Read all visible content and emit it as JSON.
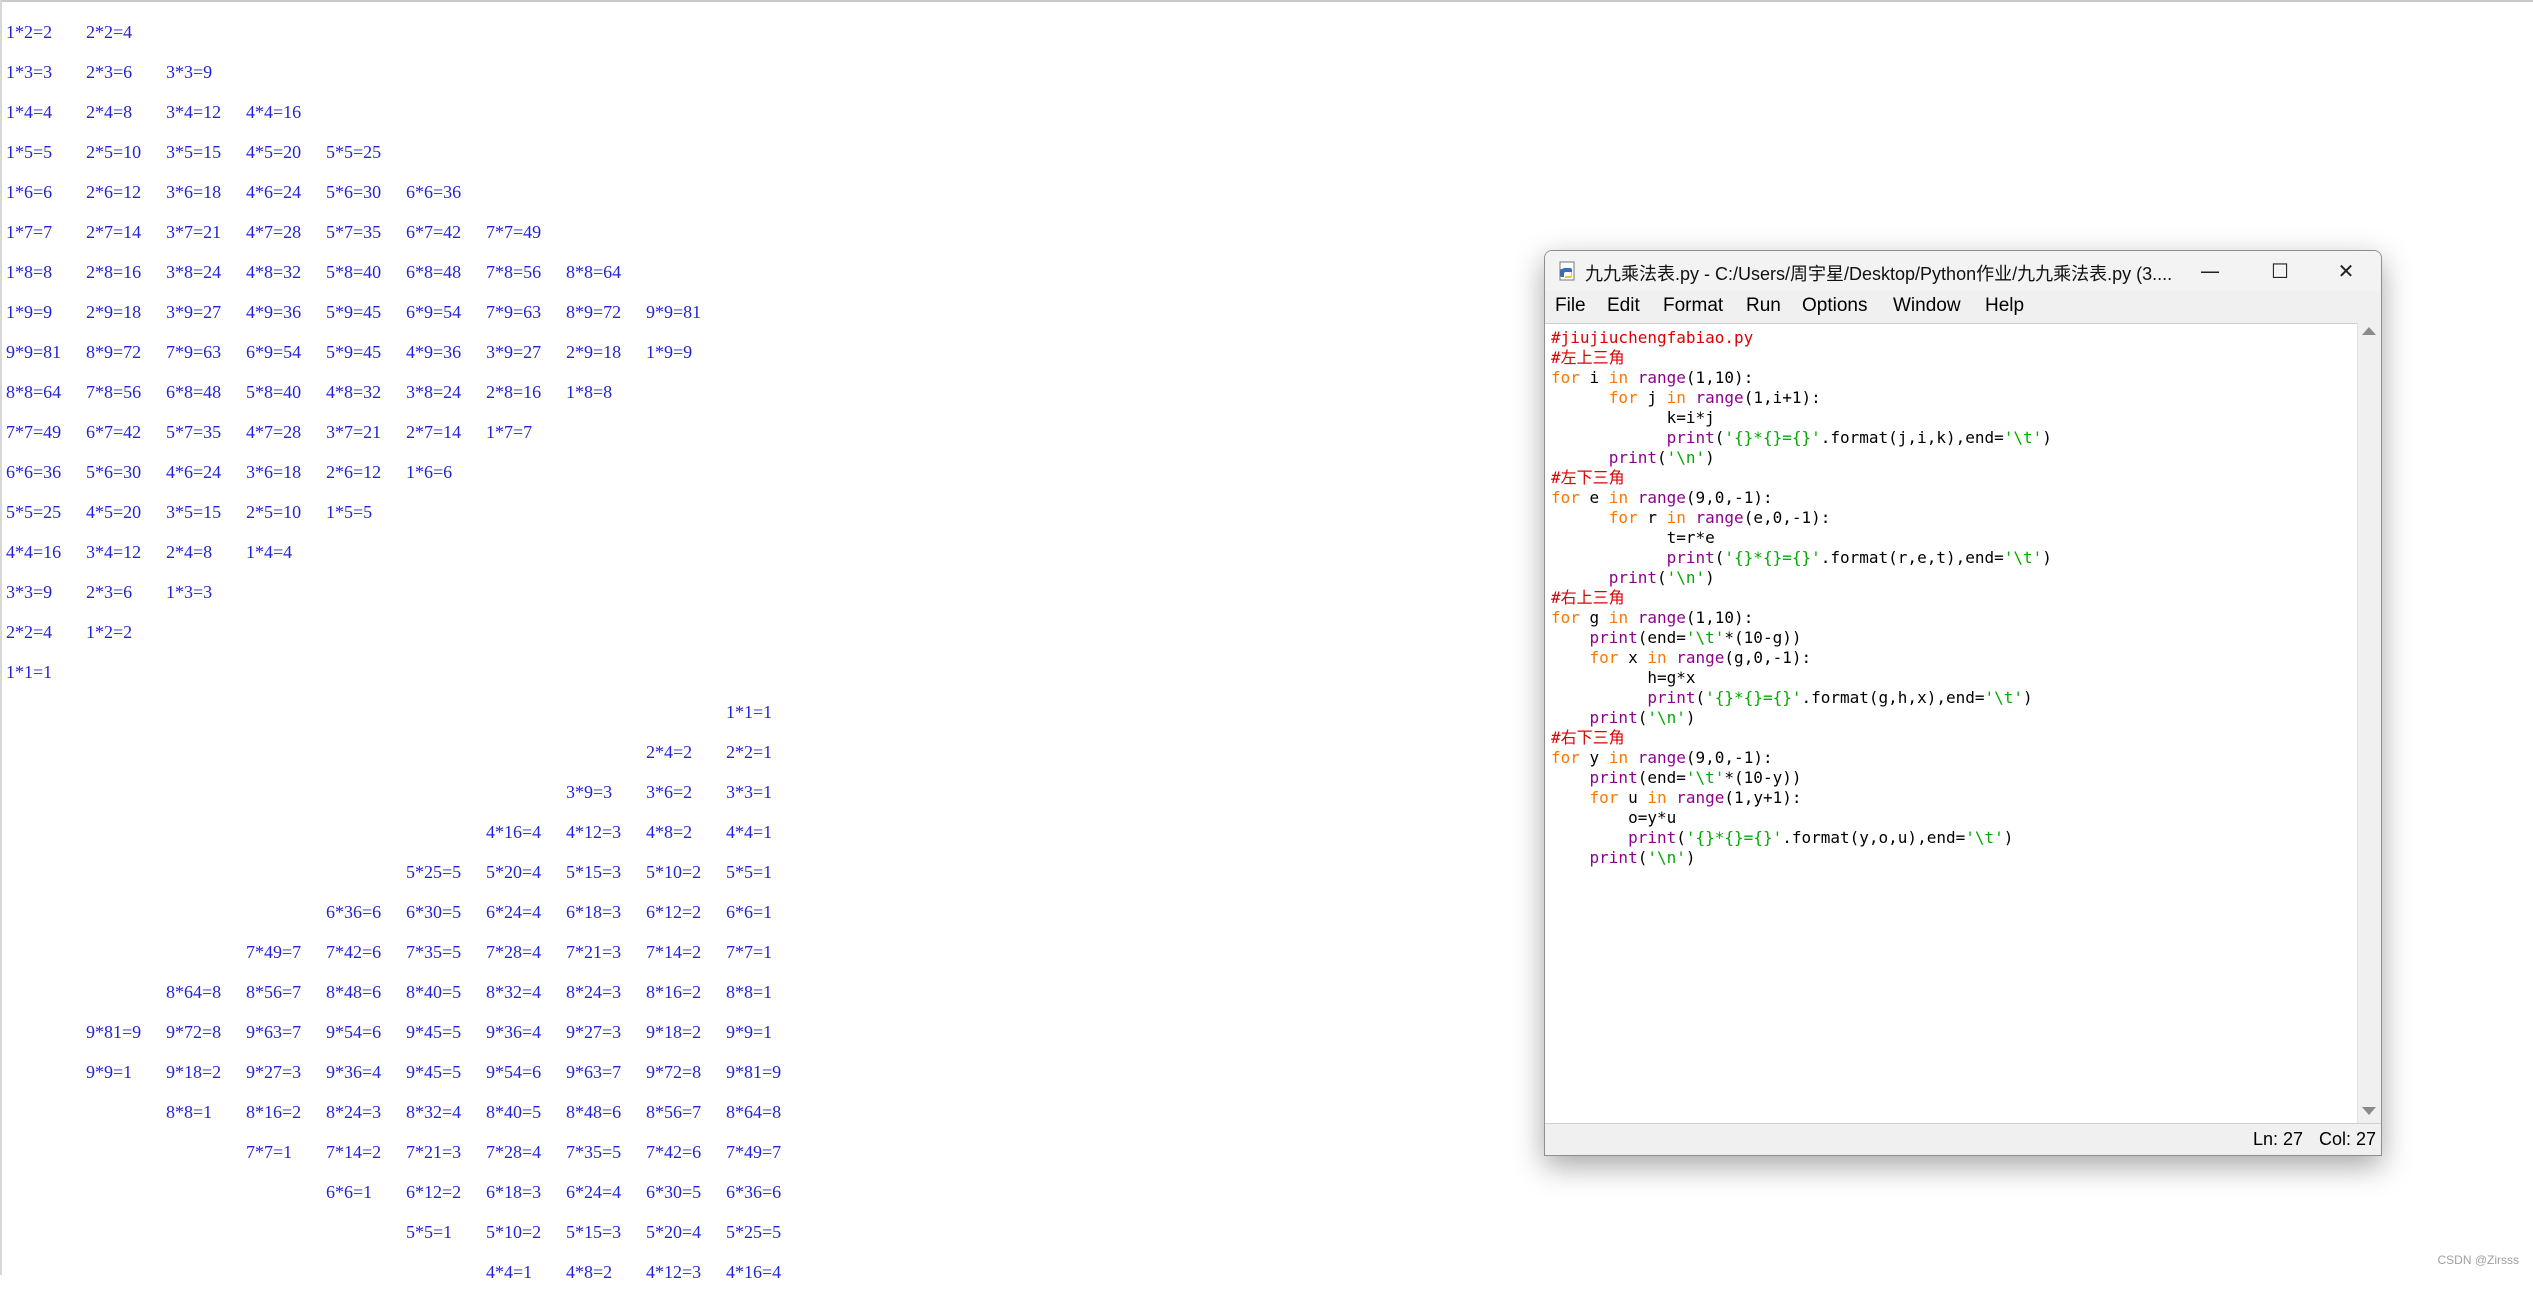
{
  "shell_output": [
    [
      "1*2=2",
      "2*2=4",
      "",
      "",
      "",
      "",
      "",
      "",
      ""
    ],
    [
      "1*3=3",
      "2*3=6",
      "3*3=9",
      "",
      "",
      "",
      "",
      "",
      ""
    ],
    [
      "1*4=4",
      "2*4=8",
      "3*4=12",
      "4*4=16",
      "",
      "",
      "",
      "",
      ""
    ],
    [
      "1*5=5",
      "2*5=10",
      "3*5=15",
      "4*5=20",
      "5*5=25",
      "",
      "",
      "",
      ""
    ],
    [
      "1*6=6",
      "2*6=12",
      "3*6=18",
      "4*6=24",
      "5*6=30",
      "6*6=36",
      "",
      "",
      ""
    ],
    [
      "1*7=7",
      "2*7=14",
      "3*7=21",
      "4*7=28",
      "5*7=35",
      "6*7=42",
      "7*7=49",
      "",
      ""
    ],
    [
      "1*8=8",
      "2*8=16",
      "3*8=24",
      "4*8=32",
      "5*8=40",
      "6*8=48",
      "7*8=56",
      "8*8=64",
      ""
    ],
    [
      "1*9=9",
      "2*9=18",
      "3*9=27",
      "4*9=36",
      "5*9=45",
      "6*9=54",
      "7*9=63",
      "8*9=72",
      "9*9=81"
    ],
    [
      "9*9=81",
      "8*9=72",
      "7*9=63",
      "6*9=54",
      "5*9=45",
      "4*9=36",
      "3*9=27",
      "2*9=18",
      "1*9=9"
    ],
    [
      "8*8=64",
      "7*8=56",
      "6*8=48",
      "5*8=40",
      "4*8=32",
      "3*8=24",
      "2*8=16",
      "1*8=8",
      ""
    ],
    [
      "7*7=49",
      "6*7=42",
      "5*7=35",
      "4*7=28",
      "3*7=21",
      "2*7=14",
      "1*7=7",
      "",
      ""
    ],
    [
      "6*6=36",
      "5*6=30",
      "4*6=24",
      "3*6=18",
      "2*6=12",
      "1*6=6",
      "",
      "",
      ""
    ],
    [
      "5*5=25",
      "4*5=20",
      "3*5=15",
      "2*5=10",
      "1*5=5",
      "",
      "",
      "",
      ""
    ],
    [
      "4*4=16",
      "3*4=12",
      "2*4=8",
      "1*4=4",
      "",
      "",
      "",
      "",
      ""
    ],
    [
      "3*3=9",
      "2*3=6",
      "1*3=3",
      "",
      "",
      "",
      "",
      "",
      ""
    ],
    [
      "2*2=4",
      "1*2=2",
      "",
      "",
      "",
      "",
      "",
      "",
      ""
    ],
    [
      "1*1=1",
      "",
      "",
      "",
      "",
      "",
      "",
      "",
      ""
    ],
    [
      "",
      "",
      "",
      "",
      "",
      "",
      "",
      "",
      "",
      "1*1=1"
    ],
    [
      "",
      "",
      "",
      "",
      "",
      "",
      "",
      "",
      "2*4=2",
      "2*2=1"
    ],
    [
      "",
      "",
      "",
      "",
      "",
      "",
      "",
      "3*9=3",
      "3*6=2",
      "3*3=1"
    ],
    [
      "",
      "",
      "",
      "",
      "",
      "",
      "4*16=4",
      "4*12=3",
      "4*8=2",
      "4*4=1"
    ],
    [
      "",
      "",
      "",
      "",
      "",
      "5*25=5",
      "5*20=4",
      "5*15=3",
      "5*10=2",
      "5*5=1"
    ],
    [
      "",
      "",
      "",
      "",
      "6*36=6",
      "6*30=5",
      "6*24=4",
      "6*18=3",
      "6*12=2",
      "6*6=1"
    ],
    [
      "",
      "",
      "",
      "7*49=7",
      "7*42=6",
      "7*35=5",
      "7*28=4",
      "7*21=3",
      "7*14=2",
      "7*7=1"
    ],
    [
      "",
      "",
      "8*64=8",
      "8*56=7",
      "8*48=6",
      "8*40=5",
      "8*32=4",
      "8*24=3",
      "8*16=2",
      "8*8=1"
    ],
    [
      "",
      "9*81=9",
      "9*72=8",
      "9*63=7",
      "9*54=6",
      "9*45=5",
      "9*36=4",
      "9*27=3",
      "9*18=2",
      "9*9=1"
    ],
    [
      "",
      "9*9=1",
      "9*18=2",
      "9*27=3",
      "9*36=4",
      "9*45=5",
      "9*54=6",
      "9*63=7",
      "9*72=8",
      "9*81=9"
    ],
    [
      "",
      "",
      "8*8=1",
      "8*16=2",
      "8*24=3",
      "8*32=4",
      "8*40=5",
      "8*48=6",
      "8*56=7",
      "8*64=8"
    ],
    [
      "",
      "",
      "",
      "7*7=1",
      "7*14=2",
      "7*21=3",
      "7*28=4",
      "7*35=5",
      "7*42=6",
      "7*49=7"
    ],
    [
      "",
      "",
      "",
      "",
      "6*6=1",
      "6*12=2",
      "6*18=3",
      "6*24=4",
      "6*30=5",
      "6*36=6"
    ],
    [
      "",
      "",
      "",
      "",
      "",
      "5*5=1",
      "5*10=2",
      "5*15=3",
      "5*20=4",
      "5*25=5"
    ],
    [
      "",
      "",
      "",
      "",
      "",
      "",
      "4*4=1",
      "4*8=2",
      "4*12=3",
      "4*16=4"
    ]
  ],
  "window": {
    "title": "九九乘法表.py - C:/Users/周宇星/Desktop/Python作业/九九乘法表.py (3....",
    "controls": {
      "minimize": "—",
      "maximize": "☐",
      "close": "✕"
    },
    "menu": [
      "File",
      "Edit",
      "Format",
      "Run",
      "Options",
      "Window",
      "Help"
    ],
    "code": [
      [
        [
          "cm",
          "#jiujiuchengfabiao.py"
        ]
      ],
      [
        [
          "cm",
          "#左上三角"
        ]
      ],
      [
        [
          "kw",
          "for"
        ],
        [
          "t",
          " i "
        ],
        [
          "kw",
          "in"
        ],
        [
          "t",
          " "
        ],
        [
          "bi",
          "range"
        ],
        [
          "t",
          "(1,10):"
        ]
      ],
      [
        [
          "t",
          "      "
        ],
        [
          "kw",
          "for"
        ],
        [
          "t",
          " j "
        ],
        [
          "kw",
          "in"
        ],
        [
          "t",
          " "
        ],
        [
          "bi",
          "range"
        ],
        [
          "t",
          "(1,i+1):"
        ]
      ],
      [
        [
          "t",
          "            k=i*j"
        ]
      ],
      [
        [
          "t",
          "            "
        ],
        [
          "bi",
          "print"
        ],
        [
          "t",
          "("
        ],
        [
          "st",
          "'{}*{}={}'"
        ],
        [
          "t",
          ".format(j,i,k),end="
        ],
        [
          "st",
          "'\\t'"
        ],
        [
          "t",
          ")"
        ]
      ],
      [
        [
          "t",
          "      "
        ],
        [
          "bi",
          "print"
        ],
        [
          "t",
          "("
        ],
        [
          "st",
          "'\\n'"
        ],
        [
          "t",
          ")"
        ]
      ],
      [
        [
          "cm",
          "#左下三角"
        ]
      ],
      [
        [
          "kw",
          "for"
        ],
        [
          "t",
          " e "
        ],
        [
          "kw",
          "in"
        ],
        [
          "t",
          " "
        ],
        [
          "bi",
          "range"
        ],
        [
          "t",
          "(9,0,-1):"
        ]
      ],
      [
        [
          "t",
          "      "
        ],
        [
          "kw",
          "for"
        ],
        [
          "t",
          " r "
        ],
        [
          "kw",
          "in"
        ],
        [
          "t",
          " "
        ],
        [
          "bi",
          "range"
        ],
        [
          "t",
          "(e,0,-1):"
        ]
      ],
      [
        [
          "t",
          "            t=r*e"
        ]
      ],
      [
        [
          "t",
          "            "
        ],
        [
          "bi",
          "print"
        ],
        [
          "t",
          "("
        ],
        [
          "st",
          "'{}*{}={}'"
        ],
        [
          "t",
          ".format(r,e,t),end="
        ],
        [
          "st",
          "'\\t'"
        ],
        [
          "t",
          ")"
        ]
      ],
      [
        [
          "t",
          "      "
        ],
        [
          "bi",
          "print"
        ],
        [
          "t",
          "("
        ],
        [
          "st",
          "'\\n'"
        ],
        [
          "t",
          ")"
        ]
      ],
      [
        [
          "cm",
          "#右上三角"
        ]
      ],
      [
        [
          "kw",
          "for"
        ],
        [
          "t",
          " g "
        ],
        [
          "kw",
          "in"
        ],
        [
          "t",
          " "
        ],
        [
          "bi",
          "range"
        ],
        [
          "t",
          "(1,10):"
        ]
      ],
      [
        [
          "t",
          "    "
        ],
        [
          "bi",
          "print"
        ],
        [
          "t",
          "(end="
        ],
        [
          "st",
          "'\\t'"
        ],
        [
          "t",
          "*(10-g))"
        ]
      ],
      [
        [
          "t",
          "    "
        ],
        [
          "kw",
          "for"
        ],
        [
          "t",
          " x "
        ],
        [
          "kw",
          "in"
        ],
        [
          "t",
          " "
        ],
        [
          "bi",
          "range"
        ],
        [
          "t",
          "(g,0,-1):"
        ]
      ],
      [
        [
          "t",
          "          h=g*x"
        ]
      ],
      [
        [
          "t",
          "          "
        ],
        [
          "bi",
          "print"
        ],
        [
          "t",
          "("
        ],
        [
          "st",
          "'{}*{}={}'"
        ],
        [
          "t",
          ".format(g,h,x),end="
        ],
        [
          "st",
          "'\\t'"
        ],
        [
          "t",
          ")"
        ]
      ],
      [
        [
          "t",
          "    "
        ],
        [
          "bi",
          "print"
        ],
        [
          "t",
          "("
        ],
        [
          "st",
          "'\\n'"
        ],
        [
          "t",
          ")"
        ]
      ],
      [
        [
          "cm",
          "#右下三角"
        ]
      ],
      [
        [
          "kw",
          "for"
        ],
        [
          "t",
          " y "
        ],
        [
          "kw",
          "in"
        ],
        [
          "t",
          " "
        ],
        [
          "bi",
          "range"
        ],
        [
          "t",
          "(9,0,-1):"
        ]
      ],
      [
        [
          "t",
          "    "
        ],
        [
          "bi",
          "print"
        ],
        [
          "t",
          "(end="
        ],
        [
          "st",
          "'\\t'"
        ],
        [
          "t",
          "*(10-y))"
        ]
      ],
      [
        [
          "t",
          "    "
        ],
        [
          "kw",
          "for"
        ],
        [
          "t",
          " u "
        ],
        [
          "kw",
          "in"
        ],
        [
          "t",
          " "
        ],
        [
          "bi",
          "range"
        ],
        [
          "t",
          "(1,y+1):"
        ]
      ],
      [
        [
          "t",
          "        o=y*u"
        ]
      ],
      [
        [
          "t",
          "        "
        ],
        [
          "bi",
          "print"
        ],
        [
          "t",
          "("
        ],
        [
          "st",
          "'{}*{}={}'"
        ],
        [
          "t",
          ".format(y,o,u),end="
        ],
        [
          "st",
          "'\\t'"
        ],
        [
          "t",
          ")"
        ]
      ],
      [
        [
          "t",
          "    "
        ],
        [
          "bi",
          "print"
        ],
        [
          "t",
          "("
        ],
        [
          "st",
          "'\\n'"
        ],
        [
          "t",
          ")"
        ]
      ]
    ],
    "status": {
      "line": "Ln: 27",
      "col": "Col: 27"
    }
  },
  "watermark": "CSDN @Zirsss",
  "colors": {
    "output_text": "#2323d6",
    "keyword": "#ff7700",
    "builtin": "#900090",
    "string": "#00aa00",
    "comment": "#dd0000"
  }
}
